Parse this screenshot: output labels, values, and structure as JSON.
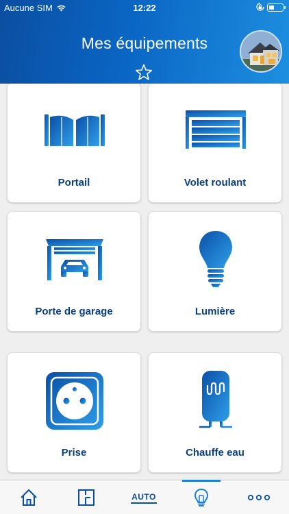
{
  "status_bar": {
    "carrier": "Aucune SIM",
    "time": "12:22"
  },
  "header": {
    "title": "Mes équipements"
  },
  "equipment": [
    {
      "label": "Portail",
      "icon": "gate-icon"
    },
    {
      "label": "Volet roulant",
      "icon": "rolling-shutter-icon"
    },
    {
      "label": "Porte de garage",
      "icon": "garage-door-icon"
    },
    {
      "label": "Lumière",
      "icon": "light-bulb-icon"
    },
    {
      "label": "Prise",
      "icon": "power-outlet-icon"
    },
    {
      "label": "Chauffe eau",
      "icon": "water-heater-icon"
    }
  ],
  "tabbar": {
    "auto_label": "AUTO",
    "active_tab": "devices",
    "items": [
      "home-icon",
      "floor-plan-icon",
      "auto",
      "light-bulb-icon",
      "more-icon"
    ]
  },
  "colors": {
    "brand_dark": "#0b4ea2",
    "brand_light": "#1d8fe0",
    "label": "#0a3f80",
    "icon_gradient_start": "#0a5bb5",
    "icon_gradient_end": "#2a9ae6"
  }
}
